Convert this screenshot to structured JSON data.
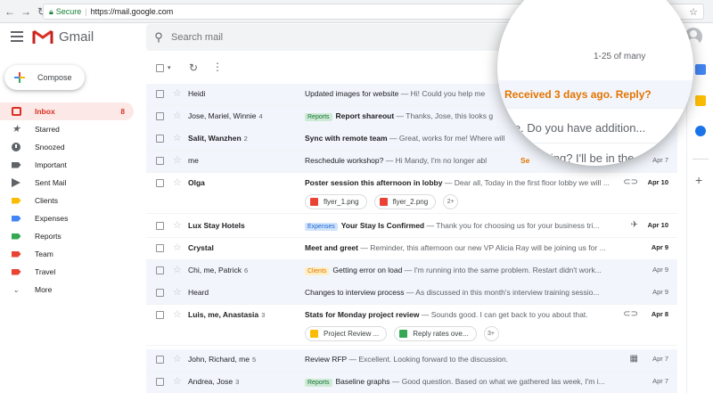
{
  "browser": {
    "secure_label": "Secure",
    "url": "https://mail.google.com"
  },
  "header": {
    "app_name": "Gmail",
    "search_placeholder": "Search mail"
  },
  "sidebar": {
    "compose_label": "Compose",
    "items": [
      {
        "label": "Inbox",
        "count": "8",
        "icon": "inbox-icon"
      },
      {
        "label": "Starred",
        "icon": "star-icon"
      },
      {
        "label": "Snoozed",
        "icon": "clock-icon"
      },
      {
        "label": "Important",
        "icon": "important-label-icon",
        "color": "#5f6368"
      },
      {
        "label": "Sent Mail",
        "icon": "send-icon"
      },
      {
        "label": "Clients",
        "icon": "label-icon",
        "color": "#fbbc04"
      },
      {
        "label": "Expenses",
        "icon": "label-icon",
        "color": "#4285f4"
      },
      {
        "label": "Reports",
        "icon": "label-icon",
        "color": "#34a853"
      },
      {
        "label": "Team",
        "icon": "label-icon",
        "color": "#ea4335"
      },
      {
        "label": "Travel",
        "icon": "label-icon",
        "color": "#ea4335"
      },
      {
        "label": "More",
        "icon": "chevron-down-icon"
      }
    ]
  },
  "toolbar": {
    "page_range": "1-25 of many"
  },
  "emails": [
    {
      "sender": "Heidi",
      "count": "",
      "tag": "",
      "subject": "Updated images for website",
      "snippet": "— Hi! Could you help me"
    },
    {
      "sender": "Jose, Mariel, Winnie",
      "count": "4",
      "tag": "Reports",
      "subject": "Report shareout",
      "snippet": "— Thanks, Jose, this looks g"
    },
    {
      "sender": "Salit, Wanzhen",
      "count": "2",
      "tag": "",
      "subject": "Sync with remote team",
      "snippet": "— Great, works for me! Where will"
    },
    {
      "sender": "me",
      "count": "",
      "tag": "",
      "subject": "Reschedule workshop?",
      "snippet": "— Hi Mandy, I'm no longer abl",
      "date": "Apr 7",
      "snippet_tail": "Se"
    },
    {
      "sender": "Olga",
      "count": "",
      "tag": "",
      "subject": "Poster session this afternoon in lobby",
      "snippet": "— Dear all, Today in the first floor lobby we will ...",
      "date": "Apr 10",
      "attachments": [
        "flyer_1.png",
        "flyer_2.png"
      ],
      "more": "2+"
    },
    {
      "sender": "Lux Stay Hotels",
      "count": "",
      "tag": "Expenses",
      "subject": "Your Stay Is Confirmed",
      "snippet": "— Thank you for choosing us for your business tri...",
      "date": "Apr 10"
    },
    {
      "sender": "Crystal",
      "count": "",
      "tag": "",
      "subject": "Meet and greet",
      "snippet": "— Reminder, this afternoon our new VP Alicia Ray will be joining us for ...",
      "date": "Apr 9"
    },
    {
      "sender": "Chi, me, Patrick",
      "count": "6",
      "tag": "Clients",
      "subject": "Getting error on load",
      "snippet": "— I'm running into the same problem. Restart didn't work...",
      "date": "Apr 9"
    },
    {
      "sender": "Heard",
      "count": "",
      "tag": "",
      "subject": "Changes to interview process",
      "snippet": "— As discussed in this month's interview training sessio...",
      "date": "Apr 9"
    },
    {
      "sender": "Luis, me, Anastasia",
      "count": "3",
      "tag": "",
      "subject": "Stats for Monday project review",
      "snippet": "— Sounds good. I can get back to you about that.",
      "date": "Apr 8",
      "attachments": [
        "Project Review ...",
        "Reply rates ove..."
      ],
      "more": "3+"
    },
    {
      "sender": "John, Richard, me",
      "count": "5",
      "tag": "",
      "subject": "Review RFP",
      "snippet": "— Excellent. Looking forward to the discussion.",
      "date": "Apr 7"
    },
    {
      "sender": "Andrea, Jose",
      "count": "3",
      "tag": "Reports",
      "subject": "Baseline graphs",
      "snippet": "— Good question. Based on what we gathered las week, I'm i...",
      "date": "Apr 7"
    }
  ],
  "magnifier": {
    "reply_nudge": "Received 3 days ago. Reply?",
    "line2": "me. Do you have addition...",
    "line3": "staying? I'll be in the"
  },
  "colors": {
    "accent_red": "#d93025",
    "nudge_orange": "#e37400"
  }
}
